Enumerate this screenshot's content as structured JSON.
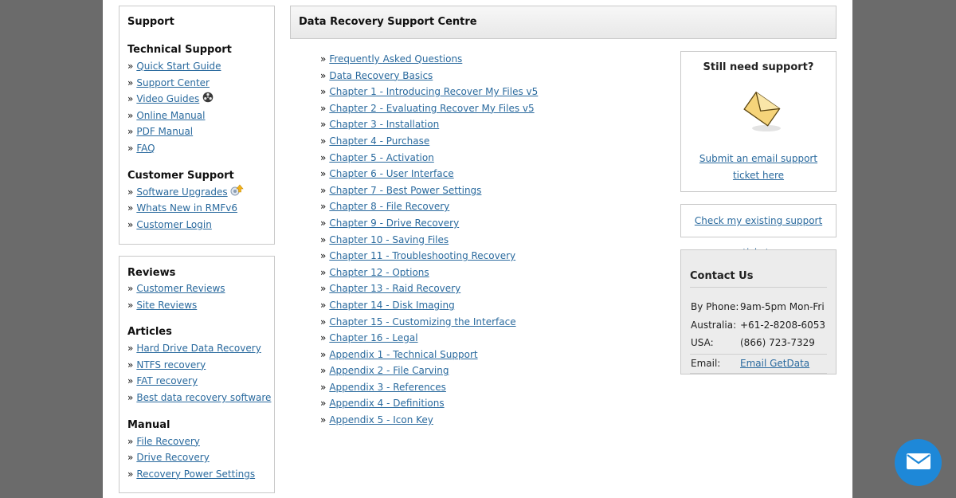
{
  "sidebar": {
    "support_box": {
      "title": "Support",
      "technical": {
        "heading": "Technical Support",
        "items": [
          "Quick Start Guide",
          "Support Center",
          "Video Guides",
          "Online Manual",
          "PDF Manual",
          "FAQ"
        ]
      },
      "customer": {
        "heading": "Customer Support",
        "items": [
          "Software Upgrades",
          "Whats New in RMFv6",
          "Customer Login"
        ]
      }
    },
    "reviews_box": {
      "reviews": {
        "heading": "Reviews",
        "items": [
          "Customer Reviews",
          "Site Reviews"
        ]
      },
      "articles": {
        "heading": "Articles",
        "items": [
          "Hard Drive Data Recovery",
          "NTFS recovery",
          "FAT recovery",
          "Best data recovery software"
        ]
      },
      "manual": {
        "heading": "Manual",
        "items": [
          "File Recovery",
          "Drive Recovery",
          "Recovery Power Settings"
        ]
      }
    },
    "bullet": "»"
  },
  "main": {
    "title": "Data Recovery Support Centre",
    "links": [
      "Frequently Asked Questions",
      "Data Recovery Basics",
      "Chapter 1 - Introducing Recover My Files v5",
      "Chapter 2 - Evaluating Recover My Files v5",
      "Chapter 3 - Installation",
      "Chapter 4 - Purchase",
      "Chapter 5 - Activation",
      "Chapter 6 - User Interface",
      "Chapter 7 - Best Power Settings",
      "Chapter 8 - File Recovery",
      "Chapter 9 - Drive Recovery",
      "Chapter 10 - Saving Files",
      "Chapter 11 - Troubleshooting Recovery",
      "Chapter 12 - Options",
      "Chapter 13 - Raid Recovery",
      "Chapter 14 - Disk Imaging",
      "Chapter 15 - Customizing the Interface",
      "Chapter 16 - Legal",
      "Appendix 1 - Technical Support",
      "Appendix 2 - File Carving",
      "Appendix 3 - References",
      "Appendix 4 - Definitions",
      "Appendix 5 - Icon Key"
    ]
  },
  "right": {
    "still_title": "Still need support?",
    "submit_line1": "Submit an email support",
    "submit_line2": "ticket here",
    "check_tickets": "Check my existing support tickets",
    "contact": {
      "title": "Contact Us",
      "rows": [
        {
          "k": "By Phone:",
          "v": "9am-5pm Mon-Fri"
        },
        {
          "k": "Australia:",
          "v": "+61-2-8208-6053"
        },
        {
          "k": "USA:",
          "v": "(866) 723-7329"
        }
      ],
      "email_label": "Email:",
      "email_link": "Email GetData"
    }
  },
  "colors": {
    "link": "#2a6a9e",
    "chat_button": "#1e88d8",
    "outer_bg": "#6b6b6b"
  },
  "icons": {
    "video": "film-reel-icon",
    "upgrade": "upgrade-icon",
    "envelope": "envelope-icon",
    "chat": "mail-icon"
  }
}
